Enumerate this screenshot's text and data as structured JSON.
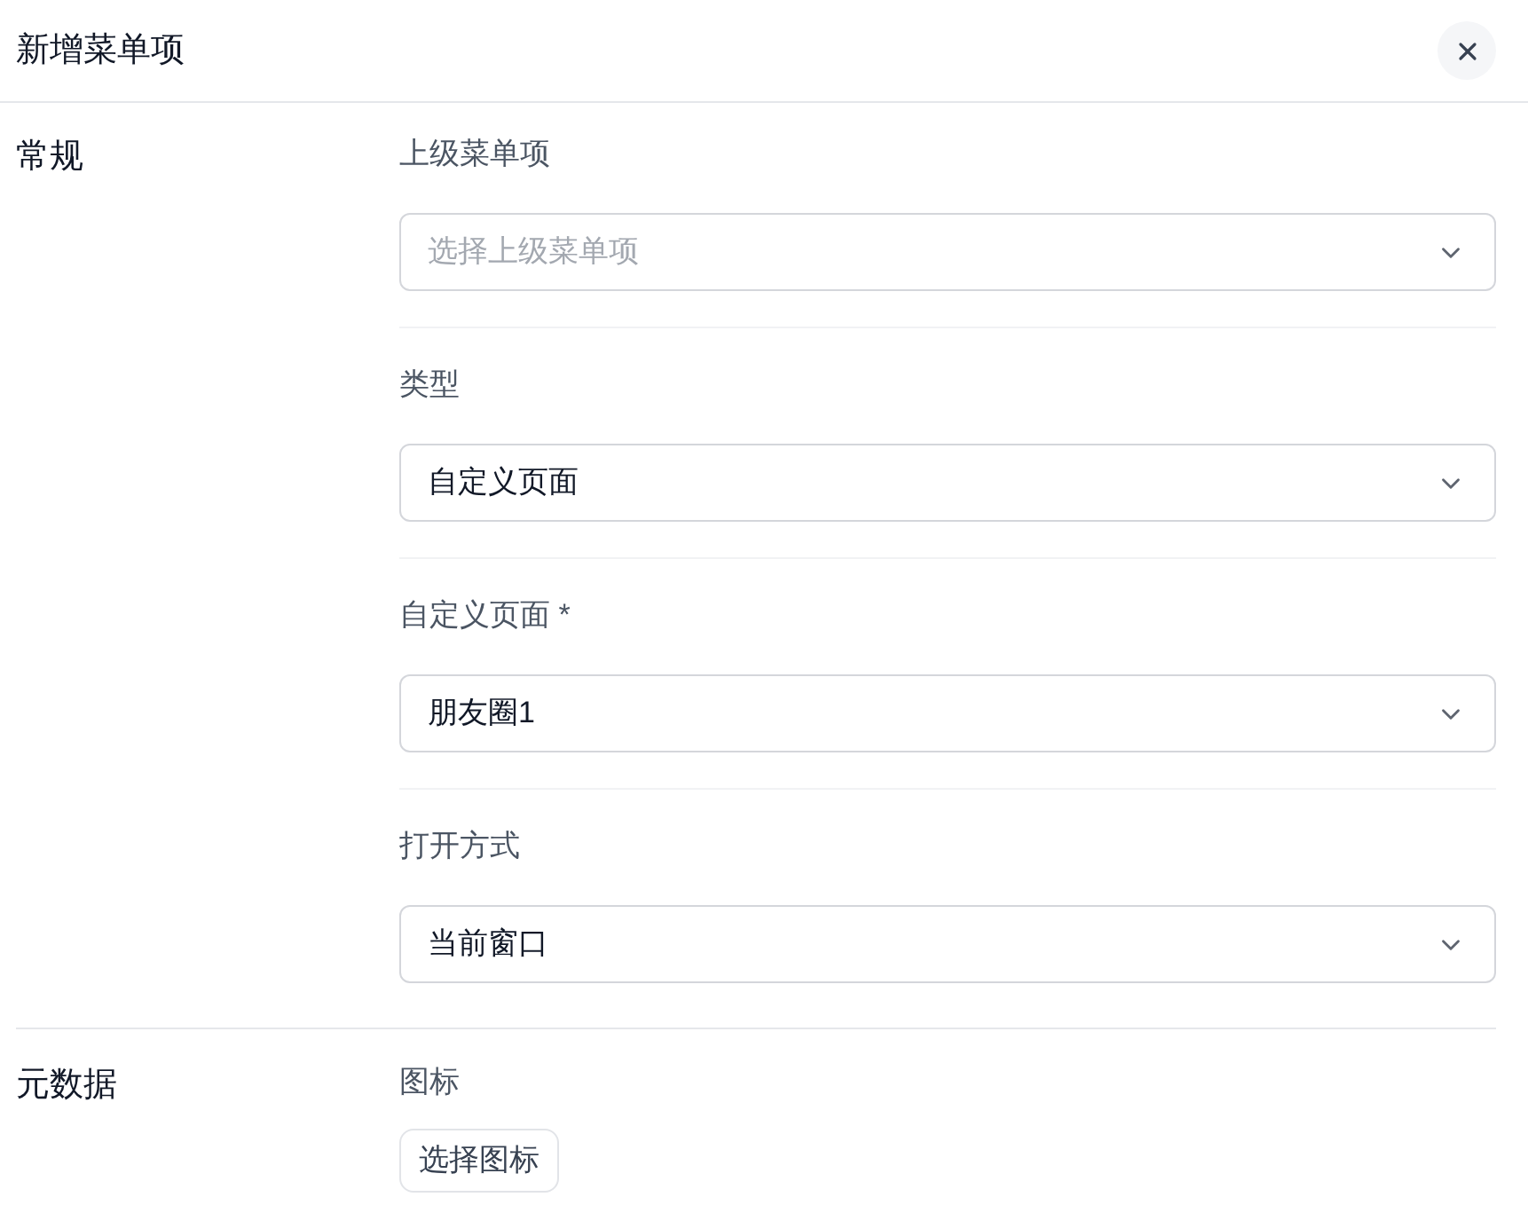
{
  "dialog": {
    "title": "新增菜单项"
  },
  "sections": [
    {
      "title": "常规",
      "fields": [
        {
          "kind": "select",
          "label": "上级菜单项",
          "placeholder": "选择上级菜单项"
        },
        {
          "kind": "select",
          "label": "类型",
          "value": "自定义页面"
        },
        {
          "kind": "select",
          "label": "自定义页面 *",
          "value": "朋友圈1"
        },
        {
          "kind": "select",
          "label": "打开方式",
          "value": "当前窗口"
        }
      ]
    },
    {
      "title": "元数据",
      "fields": [
        {
          "kind": "button",
          "label": "图标",
          "button": "选择图标"
        }
      ]
    }
  ]
}
